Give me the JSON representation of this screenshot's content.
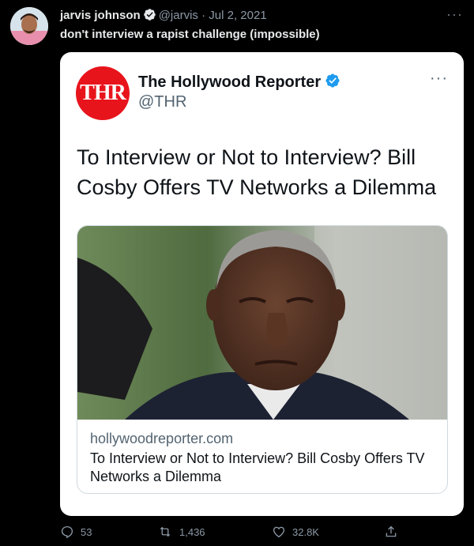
{
  "tweet": {
    "author_name": "jarvis johnson",
    "handle": "@jarvis",
    "separator": "·",
    "date": "Jul 2, 2021",
    "text": "don't interview a rapist challenge (impossible)",
    "more_label": "···"
  },
  "quoted": {
    "logo_text": "THR",
    "name": "The Hollywood Reporter",
    "handle": "@THR",
    "more_label": "···",
    "text": "To Interview or Not to Interview? Bill Cosby Offers TV Networks a Dilemma",
    "card": {
      "domain": "hollywoodreporter.com",
      "title": "To Interview or Not to Interview? Bill Cosby Offers TV Networks a Dilemma"
    }
  },
  "actions": {
    "replies": "53",
    "retweets": "1,436",
    "likes": "32.8K"
  },
  "colors": {
    "background": "#000000",
    "verified": "#1d9bf0",
    "logo_red": "#e8141c",
    "muted": "#8b98a5"
  },
  "icons": [
    "verified-icon",
    "reply-icon",
    "retweet-icon",
    "like-icon",
    "share-icon"
  ]
}
